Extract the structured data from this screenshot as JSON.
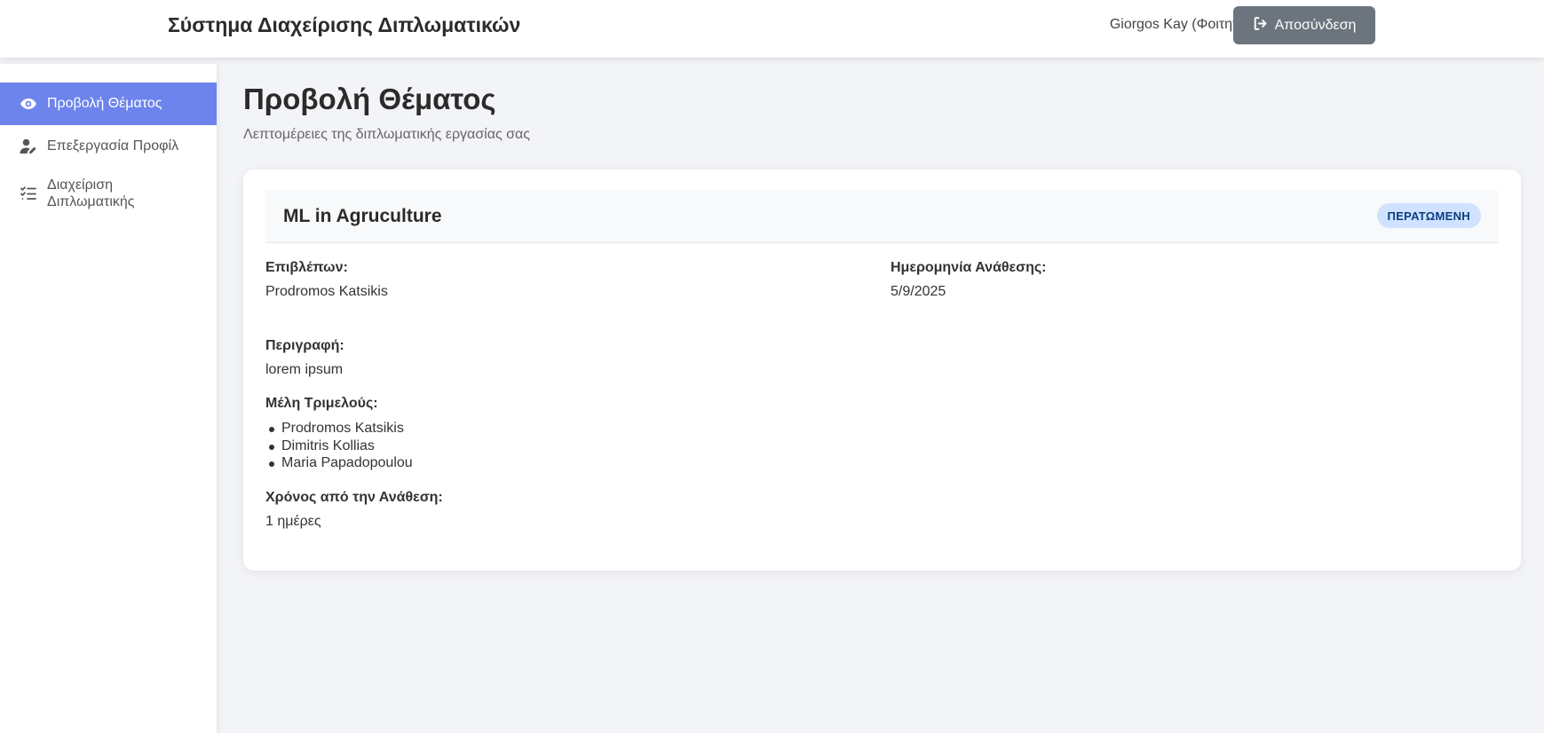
{
  "header": {
    "app_title": "Σύστημα Διαχείρισης Διπλωματικών",
    "user_name": "Giorgos Kay (Φοιτητής/τρια)",
    "logout_label": "Αποσύνδεση",
    "logout_icon": "sign-out-icon"
  },
  "sidebar": {
    "items": [
      {
        "label": "Προβολή Θέματος",
        "icon": "eye-icon",
        "active": true
      },
      {
        "label": "Επεξεργασία Προφίλ",
        "icon": "user-edit-icon",
        "active": false
      },
      {
        "label": "Διαχείριση Διπλωματικής",
        "icon": "tasks-list-icon",
        "active": false
      }
    ],
    "active_color": "#6d84ec"
  },
  "main": {
    "title": "Προβολή Θέματος",
    "subtitle": "Λεπτομέρειες της διπλωματικής εργασίας σας",
    "thesis": {
      "title": "ML in Agruculture",
      "status": "ΠΕΡΑΤΩΜΕΝΗ",
      "supervisor_label": "Επιβλέπων:",
      "supervisor": "Prodromos Katsikis",
      "assign_date_label": "Ημερομηνία Ανάθεσης:",
      "assign_date": "5/9/2025",
      "description_label": "Περιγραφή:",
      "description": "lorem ipsum",
      "committee_label": "Μέλη Τριμελούς:",
      "committee": [
        "Prodromos Katsikis",
        "Dimitris Kollias",
        "Maria Papadopoulou"
      ],
      "elapsed_label": "Χρόνος από την Ανάθεση:",
      "elapsed": "1 ημέρες"
    }
  }
}
